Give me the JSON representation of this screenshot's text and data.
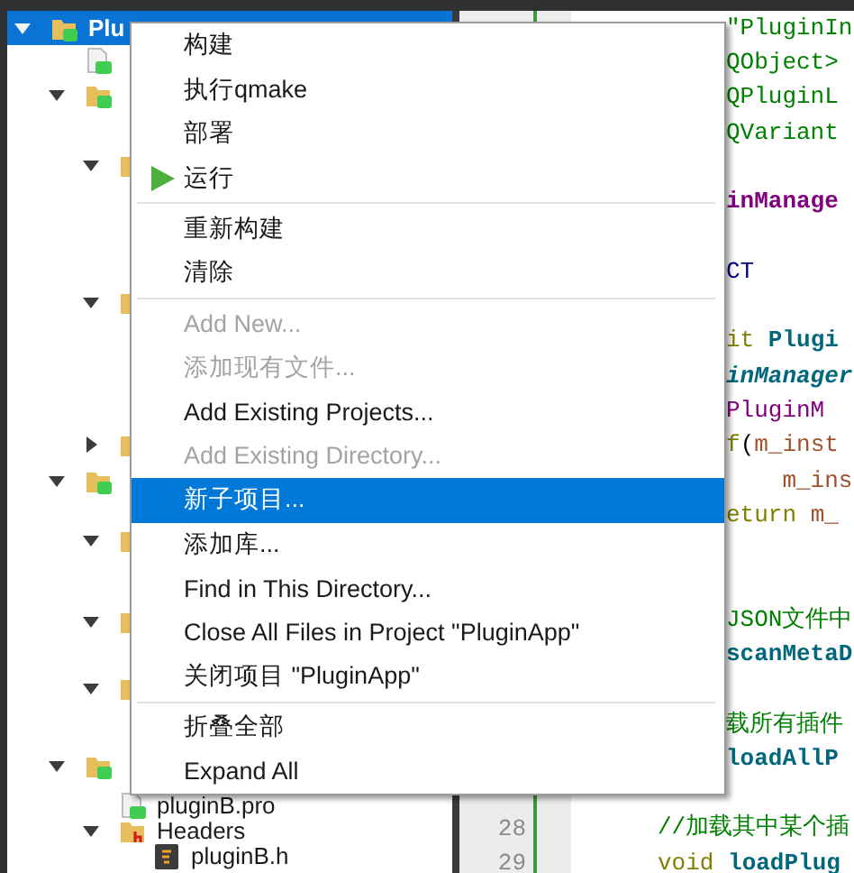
{
  "project_tree": [
    {
      "kind": "project",
      "label": "Plu",
      "expanded": true,
      "selected": true,
      "children": [
        {
          "kind": "pro_file",
          "selected": false
        },
        {
          "kind": "project",
          "expanded": true,
          "selected": false,
          "children": [
            {
              "kind": "folder",
              "expanded": true,
              "selected": false
            },
            {
              "kind": "folder",
              "expanded": true,
              "selected": false
            },
            {
              "kind": "folder",
              "expanded": false,
              "selected": false
            }
          ]
        },
        {
          "kind": "project",
          "expanded": true,
          "selected": false,
          "children": [
            {
              "kind": "folder",
              "expanded": true,
              "selected": false
            },
            {
              "kind": "folder",
              "expanded": true,
              "selected": false
            },
            {
              "kind": "folder",
              "expanded": true,
              "selected": false
            }
          ]
        },
        {
          "kind": "project",
          "expanded": true,
          "selected": false,
          "children": [
            {
              "kind": "pro_file",
              "label": "pluginB.pro",
              "selected": false
            },
            {
              "kind": "headers_folder",
              "label": "Headers",
              "expanded": true,
              "selected": false,
              "children": [
                {
                  "kind": "header_file",
                  "label": "pluginB.h",
                  "selected": false
                }
              ]
            }
          ]
        }
      ]
    }
  ],
  "context_menu": {
    "items": [
      {
        "kind": "item",
        "label": "构建",
        "disabled": false,
        "selected": false
      },
      {
        "kind": "item",
        "label": "执行qmake",
        "disabled": false,
        "selected": false
      },
      {
        "kind": "item",
        "label": "部署",
        "disabled": false,
        "selected": false
      },
      {
        "kind": "run",
        "label": "运行",
        "disabled": false,
        "selected": false
      },
      {
        "kind": "separator"
      },
      {
        "kind": "item",
        "label": "重新构建",
        "disabled": false,
        "selected": false
      },
      {
        "kind": "item",
        "label": "清除",
        "disabled": false,
        "selected": false
      },
      {
        "kind": "separator"
      },
      {
        "kind": "item",
        "label": "Add New...",
        "disabled": true,
        "selected": false
      },
      {
        "kind": "item",
        "label": "添加现有文件...",
        "disabled": true,
        "selected": false
      },
      {
        "kind": "item",
        "label": "Add Existing Projects...",
        "disabled": false,
        "selected": false
      },
      {
        "kind": "item",
        "label": "Add Existing Directory...",
        "disabled": true,
        "selected": false
      },
      {
        "kind": "item",
        "label": "新子项目...",
        "disabled": false,
        "selected": true
      },
      {
        "kind": "item",
        "label": "添加库...",
        "disabled": false,
        "selected": false
      },
      {
        "kind": "item",
        "label": "Find in This Directory...",
        "disabled": false,
        "selected": false
      },
      {
        "kind": "item",
        "label": "Close All Files in Project \"PluginApp\"",
        "disabled": false,
        "selected": false
      },
      {
        "kind": "item",
        "label": "关闭项目 \"PluginApp\"",
        "disabled": false,
        "selected": false
      },
      {
        "kind": "separator"
      },
      {
        "kind": "item",
        "label": "折叠全部",
        "disabled": false,
        "selected": false
      },
      {
        "kind": "item",
        "label": "Expand All",
        "disabled": false,
        "selected": false
      }
    ]
  },
  "editor": {
    "lines": [
      {
        "segments": [
          {
            "text": "\"PluginIn",
            "kind": "string"
          }
        ]
      },
      {
        "segments": [
          {
            "text": "QObject>",
            "kind": "string"
          }
        ]
      },
      {
        "segments": [
          {
            "text": "QPluginL",
            "kind": "string"
          }
        ]
      },
      {
        "segments": [
          {
            "text": "QVariant",
            "kind": "string"
          }
        ]
      },
      {
        "segments": [
          {
            "text": "inManage",
            "kind": "class"
          }
        ]
      },
      {
        "segments": [
          {
            "text": "CT",
            "kind": "macro"
          }
        ]
      },
      {
        "segments": [
          {
            "text": "it",
            "kind": "keyword"
          },
          {
            "text": " Plugi",
            "kind": "function"
          }
        ]
      },
      {
        "segments": [
          {
            "text": "inManager",
            "kind": "function_italic"
          }
        ]
      },
      {
        "segments": [
          {
            "text": "PluginM",
            "kind": "type"
          }
        ]
      },
      {
        "segments": [
          {
            "text": "f",
            "kind": "keyword"
          },
          {
            "text": "(",
            "kind": "plain"
          },
          {
            "text": "m_inst",
            "kind": "member"
          }
        ]
      },
      {
        "segments": [
          {
            "text": "    m_ins",
            "kind": "member"
          }
        ]
      },
      {
        "segments": [
          {
            "text": "eturn",
            "kind": "keyword"
          },
          {
            "text": " m_",
            "kind": "member"
          }
        ]
      },
      {
        "segments": [
          {
            "text": "JSON文件中",
            "kind": "comment"
          }
        ]
      },
      {
        "segments": [
          {
            "text": "scanMetaD",
            "kind": "function"
          }
        ]
      },
      {
        "segments": [
          {
            "text": "载所有插件",
            "kind": "comment"
          }
        ]
      },
      {
        "segments": [
          {
            "text": "loadAllP",
            "kind": "function"
          }
        ]
      },
      {
        "number": "28",
        "segments": [
          {
            "text": "//加载其中某个插",
            "kind": "comment"
          }
        ]
      },
      {
        "number": "29",
        "segments": [
          {
            "text": "void",
            "kind": "keyword"
          },
          {
            "text": " loadPlug",
            "kind": "function"
          }
        ]
      }
    ]
  }
}
